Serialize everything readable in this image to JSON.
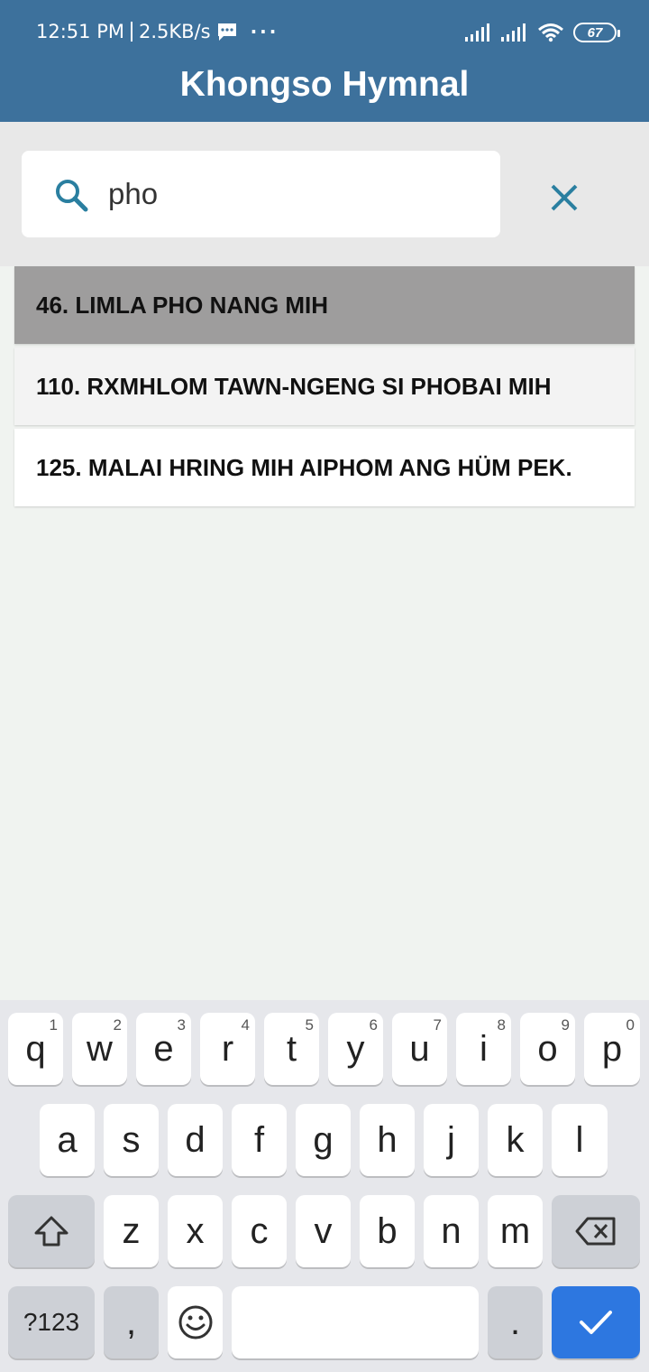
{
  "status_bar": {
    "time": "12:51 PM",
    "speed": "2.5KB/s",
    "battery": "67"
  },
  "app": {
    "title": "Khongso Hymnal"
  },
  "search": {
    "value": "pho"
  },
  "results": [
    {
      "label": "46. LIMLA PHO NANG MIH"
    },
    {
      "label": "110. RXMHLOM TAWN-NGENG SI PHOBAI MIH"
    },
    {
      "label": "125. MALAI HRING MIH AIPHOM ANG HÜM PEK."
    }
  ],
  "keyboard": {
    "row1": [
      {
        "key": "q",
        "hint": "1"
      },
      {
        "key": "w",
        "hint": "2"
      },
      {
        "key": "e",
        "hint": "3"
      },
      {
        "key": "r",
        "hint": "4"
      },
      {
        "key": "t",
        "hint": "5"
      },
      {
        "key": "y",
        "hint": "6"
      },
      {
        "key": "u",
        "hint": "7"
      },
      {
        "key": "i",
        "hint": "8"
      },
      {
        "key": "o",
        "hint": "9"
      },
      {
        "key": "p",
        "hint": "0"
      }
    ],
    "row2": [
      "a",
      "s",
      "d",
      "f",
      "g",
      "h",
      "j",
      "k",
      "l"
    ],
    "row3": [
      "z",
      "x",
      "c",
      "v",
      "b",
      "n",
      "m"
    ],
    "symbols_label": "?123",
    "comma": ",",
    "period": "."
  },
  "colors": {
    "header": "#3d719c",
    "accent": "#2a7fa0",
    "selected_row": "#9e9d9d",
    "enter_key": "#2d77e0"
  }
}
